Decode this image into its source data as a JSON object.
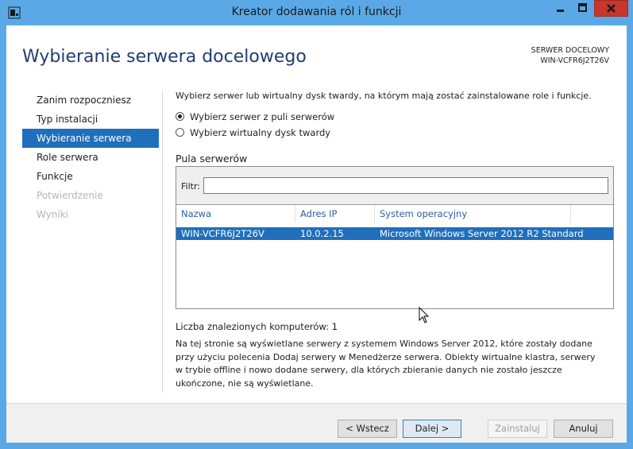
{
  "window": {
    "title": "Kreator dodawania ról i funkcji",
    "controls": {
      "minimize": "minimize-icon",
      "maximize": "maximize-icon",
      "close": "close-icon"
    }
  },
  "header": {
    "page_title": "Wybieranie serwera docelowego",
    "destination_caption": "SERWER DOCELOWY",
    "destination_server": "WIN-VCFR6J2T26V"
  },
  "nav": {
    "items": [
      {
        "label": "Zanim rozpoczniesz",
        "state": "normal"
      },
      {
        "label": "Typ instalacji",
        "state": "normal"
      },
      {
        "label": "Wybieranie serwera",
        "state": "selected"
      },
      {
        "label": "Role serwera",
        "state": "normal"
      },
      {
        "label": "Funkcje",
        "state": "normal"
      },
      {
        "label": "Potwierdzenie",
        "state": "disabled"
      },
      {
        "label": "Wyniki",
        "state": "disabled"
      }
    ]
  },
  "main": {
    "intro": "Wybierz serwer lub wirtualny dysk twardy, na którym mają zostać zainstalowane role i funkcje.",
    "options": [
      {
        "label": "Wybierz serwer z puli serwerów",
        "checked": true
      },
      {
        "label": "Wybierz wirtualny dysk twardy",
        "checked": false
      }
    ],
    "pool_label": "Pula serwerów",
    "filter_label": "Filtr:",
    "filter_value": "",
    "columns": [
      "Nazwa",
      "Adres IP",
      "System operacyjny"
    ],
    "rows": [
      {
        "name": "WIN-VCFR6J2T26V",
        "ip": "10.0.2.15",
        "os": "Microsoft Windows Server 2012 R2 Standard",
        "selected": true
      }
    ],
    "count": "Liczba znalezionych komputerów: 1",
    "description": "Na tej stronie są wyświetlane serwery z systemem Windows Server 2012, które zostały dodane przy użyciu polecenia Dodaj serwery w Menedżerze serwera. Obiekty wirtualne klastra, serwery w trybie offline i nowo dodane serwery, dla których zbieranie danych nie zostało jeszcze ukończone, nie są wyświetlane."
  },
  "footer": {
    "back": "< Wstecz",
    "next": "Dalej >",
    "install": "Zainstaluj",
    "cancel": "Anuluj"
  },
  "colors": {
    "titlebar": "#5aa9e6",
    "title_text": "#1f3d73",
    "selection": "#1f6fbc",
    "close": "#c7372c"
  }
}
